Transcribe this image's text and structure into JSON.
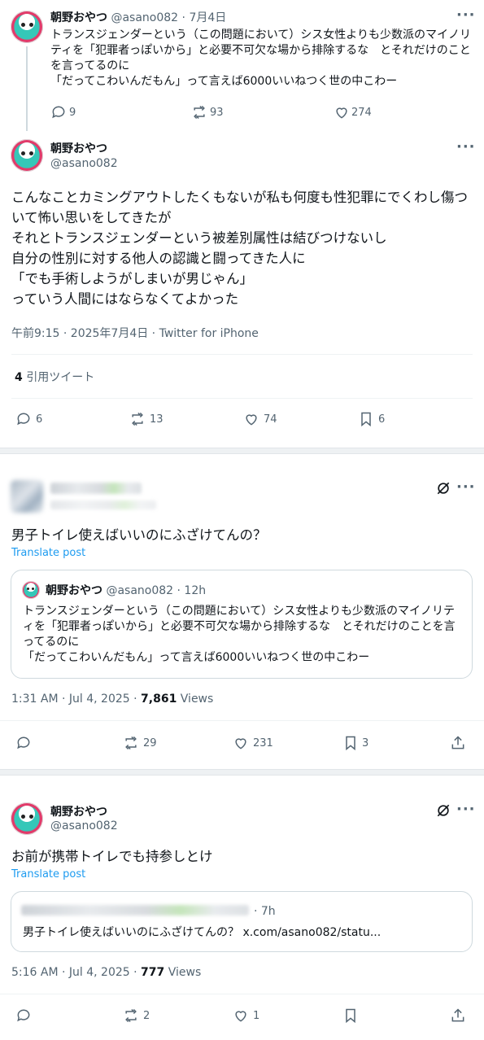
{
  "post1": {
    "display_name": "朝野おやつ",
    "handle": "@asano082",
    "date": "7月4日",
    "body": "トランスジェンダーという（この問題において）シス女性よりも少数派のマイノリティを「犯罪者っぽいから」と必要不可欠な場から排除するな　とそれだけのことを言ってるのに\n「だってこわいんだもん」って言えば6000いいねつく世の中こわー",
    "replies": "9",
    "retweets": "93",
    "likes": "274"
  },
  "post2": {
    "display_name": "朝野おやつ",
    "handle": "@asano082",
    "body": "こんなことカミングアウトしたくもないが私も何度も性犯罪にでくわし傷ついて怖い思いをしてきたが\nそれとトランスジェンダーという被差別属性は結びつけないし\n自分の性別に対する他人の認識と闘ってきた人に\n「でも手術しようがしまいが男じゃん」\nっていう人間にはならなくてよかった",
    "meta": "午前9:15 · 2025年7月4日 · Twitter for iPhone",
    "quote_count": "4",
    "quote_label": "引用ツイート",
    "replies": "6",
    "retweets": "13",
    "likes": "74",
    "bookmarks": "6"
  },
  "post3": {
    "body": "男子トイレ使えばいいのにふざけてんの？",
    "translate": "Translate post",
    "quote": {
      "display_name": "朝野おやつ",
      "handle": "@asano082",
      "time": "· 12h",
      "body": "トランスジェンダーという（この問題において）シス女性よりも少数派のマイノリティを「犯罪者っぽいから」と必要不可欠な場から排除するな　とそれだけのことを言ってるのに\n「だってこわいんだもん」って言えば6000いいねつく世の中こわー"
    },
    "meta_time": "1:31 AM · Jul 4, 2025 · ",
    "views_count": "7,861",
    "views_label": "Views",
    "replies": "",
    "retweets": "29",
    "likes": "231",
    "bookmarks": "3"
  },
  "post4": {
    "display_name": "朝野おやつ",
    "handle": "@asano082",
    "body": "お前が携帯トイレでも持参しとけ",
    "translate": "Translate post",
    "quote": {
      "time": "· 7h",
      "body": "男子トイレ使えばいいのにふざけてんの？ x.com/asano082/statu..."
    },
    "meta_time": "5:16 AM · Jul 4, 2025 · ",
    "views_count": "777",
    "views_label": "Views",
    "replies": "",
    "retweets": "2",
    "likes": "1"
  },
  "ui": {
    "more": "···",
    "colors": {
      "link": "#1d9bf0",
      "muted": "#536471",
      "border": "#cfd9de"
    },
    "icons": [
      "reply-icon",
      "retweet-icon",
      "like-icon",
      "bookmark-icon",
      "share-icon",
      "more-icon",
      "grok-icon"
    ]
  }
}
